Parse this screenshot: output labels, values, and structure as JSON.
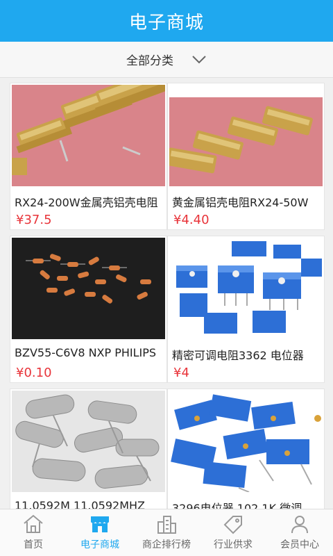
{
  "header": {
    "title": "电子商城"
  },
  "filter": {
    "label": "全部分类"
  },
  "products": [
    {
      "name": "RX24-200W金属壳铝壳电阻",
      "price": "¥37.5"
    },
    {
      "name": "黄金属铝壳电阻RX24-50W",
      "price": "¥4.40"
    },
    {
      "name": "BZV55-C6V8 NXP PHILIPS",
      "price": "¥0.10"
    },
    {
      "name": "精密可调电阻3362 电位器",
      "price": "¥4"
    },
    {
      "name": "11.0592M 11.0592MHZ",
      "price": ""
    },
    {
      "name": "3296电位器 102 1K 微调",
      "price": ""
    }
  ],
  "tabs": [
    {
      "label": "首页",
      "icon": "home-icon"
    },
    {
      "label": "电子商城",
      "icon": "store-icon"
    },
    {
      "label": "商企排行榜",
      "icon": "building-icon"
    },
    {
      "label": "行业供求",
      "icon": "tag-icon"
    },
    {
      "label": "会员中心",
      "icon": "user-icon"
    }
  ],
  "colors": {
    "brand": "#1fa8ef",
    "price": "#e8343a"
  }
}
